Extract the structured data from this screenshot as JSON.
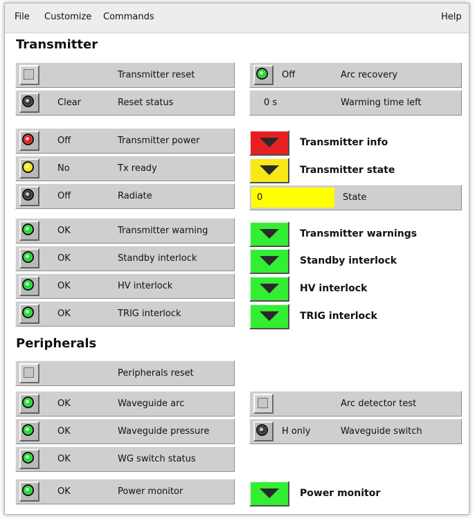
{
  "menu": {
    "file": "File",
    "customize": "Customize",
    "commands": "Commands",
    "help": "Help"
  },
  "colors": {
    "led_green": "#22dd33",
    "led_red": "#e02020",
    "led_yellow": "#f4ea12",
    "led_off": "#3a3a3a",
    "btn_green": "#33ee33",
    "btn_red": "#e62020",
    "btn_yellow": "#f7e816",
    "value_yellow": "#ffff00"
  },
  "transmitter": {
    "title": "Transmitter",
    "reset_label": "Transmitter reset",
    "reset_status_state": "Clear",
    "reset_status_label": "Reset status",
    "power_state": "Off",
    "power_label": "Transmitter power",
    "tx_ready_state": "No",
    "tx_ready_label": "Tx ready",
    "radiate_state": "Off",
    "radiate_label": "Radiate",
    "warning_state": "OK",
    "warning_label": "Transmitter warning",
    "standby_state": "OK",
    "standby_label": "Standby interlock",
    "hv_state": "OK",
    "hv_label": "HV interlock",
    "trig_state": "OK",
    "trig_label": "TRIG interlock",
    "arc_recovery_state": "Off",
    "arc_recovery_label": "Arc recovery",
    "warming_value": "0 s",
    "warming_label": "Warming time left",
    "info_label": "Transmitter info",
    "state_btn_label": "Transmitter state",
    "state_value": "0",
    "state_label": "State",
    "warnings_btn_label": "Transmitter warnings",
    "standby_btn_label": "Standby interlock",
    "hv_btn_label": "HV interlock",
    "trig_btn_label": "TRIG interlock"
  },
  "peripherals": {
    "title": "Peripherals",
    "reset_label": "Peripherals reset",
    "wg_arc_state": "OK",
    "wg_arc_label": "Waveguide arc",
    "wg_pressure_state": "OK",
    "wg_pressure_label": "Waveguide pressure",
    "wg_switch_status_state": "OK",
    "wg_switch_status_label": "WG switch status",
    "power_monitor_state": "OK",
    "power_monitor_label": "Power monitor",
    "arc_test_label": "Arc detector test",
    "wg_switch_state": "H only",
    "wg_switch_label": "Waveguide switch",
    "power_monitor_btn_label": "Power monitor"
  }
}
